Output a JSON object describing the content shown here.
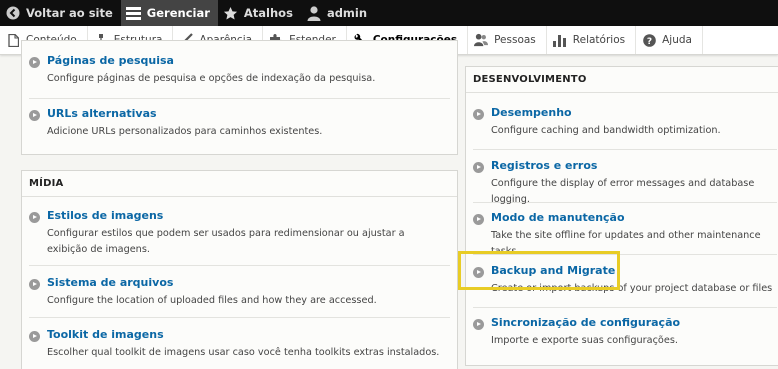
{
  "toolbar": {
    "back_label": "Voltar ao site",
    "manage_label": "Gerenciar",
    "shortcuts_label": "Atalhos",
    "user_label": "admin"
  },
  "tray": {
    "items": [
      {
        "label": "Conteúdo",
        "icon": "file-icon"
      },
      {
        "label": "Estrutura",
        "icon": "sitemap-icon"
      },
      {
        "label": "Aparência",
        "icon": "brush-icon"
      },
      {
        "label": "Estender",
        "icon": "puzzle-icon"
      },
      {
        "label": "Configurações",
        "icon": "wrench-icon",
        "active": true
      },
      {
        "label": "Pessoas",
        "icon": "people-icon"
      },
      {
        "label": "Relatórios",
        "icon": "bar-chart-icon"
      },
      {
        "label": "Ajuda",
        "icon": "help-icon"
      }
    ]
  },
  "left_top": {
    "entries": [
      {
        "title": "Páginas de pesquisa",
        "desc": "Configure páginas de pesquisa e opções de indexação da pesquisa."
      },
      {
        "title": "URLs alternativas",
        "desc": "Adicione URLs personalizados para caminhos existentes."
      }
    ]
  },
  "media": {
    "heading": "MÍDIA",
    "entries": [
      {
        "title": "Estilos de imagens",
        "desc": "Configurar estilos que podem ser usados para redimensionar ou ajustar a exibição de imagens."
      },
      {
        "title": "Sistema de arquivos",
        "desc": "Configure the location of uploaded files and how they are accessed."
      },
      {
        "title": "Toolkit de imagens",
        "desc": "Escolher qual toolkit de imagens usar caso você tenha toolkits extras instalados."
      }
    ]
  },
  "development": {
    "heading": "DESENVOLVIMENTO",
    "entries": [
      {
        "title": "Desempenho",
        "desc": "Configure caching and bandwidth optimization."
      },
      {
        "title": "Registros e erros",
        "desc": "Configure the display of error messages and database logging."
      },
      {
        "title": "Modo de manutenção",
        "desc": "Take the site offline for updates and other maintenance tasks."
      },
      {
        "title": "Backup and Migrate",
        "desc": "Create or import backups of your project database or files"
      },
      {
        "title": "Sincronização de configuração",
        "desc": "Importe e exporte suas configurações."
      }
    ]
  },
  "colors": {
    "toolbar_bg": "#0f0f0f",
    "link": "#0b67a5",
    "highlight": "#e8cc25"
  }
}
